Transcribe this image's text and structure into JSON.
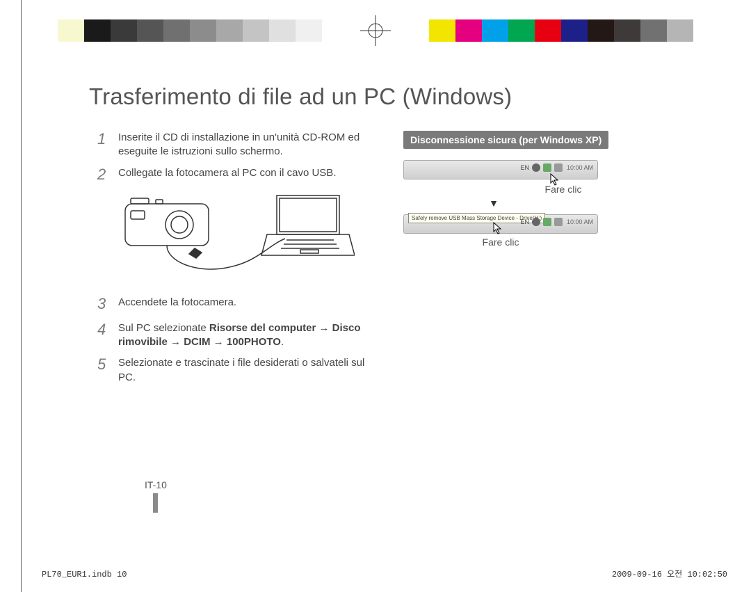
{
  "printer_colors_left": [
    "#ffffff",
    "#f8f8d0",
    "#1a1a1a",
    "#3a3a3a",
    "#555555",
    "#707070",
    "#8c8c8c",
    "#a8a8a8",
    "#c4c4c4",
    "#e0e0e0",
    "#f0f0f0",
    "#ffffff"
  ],
  "printer_colors_right": [
    "#ffffff",
    "#f2e600",
    "#e4007f",
    "#00a1e9",
    "#00a650",
    "#e60012",
    "#1d2088",
    "#231815",
    "#3e3a39",
    "#727171",
    "#b5b5b6",
    "#ffffff"
  ],
  "title": "Trasferimento di file ad un PC (Windows)",
  "steps": [
    {
      "num": "1",
      "text": "Inserite il CD di installazione in un'unità CD-ROM ed eseguite le istruzioni sullo schermo."
    },
    {
      "num": "2",
      "text": "Collegate la fotocamera al PC con il cavo USB."
    },
    {
      "num": "3",
      "text": "Accendete la fotocamera."
    },
    {
      "num": "4",
      "text_prefix": "Sul PC selezionate ",
      "bold1": "Risorse del computer",
      "arrow": " → ",
      "bold2": "Disco rimovibile → DCIM → 100PHOTO",
      "text_suffix": "."
    },
    {
      "num": "5",
      "text": "Selezionate e trascinate i file desiderati o salvateli sul PC."
    }
  ],
  "callout": "Disconnessione sicura (per Windows XP)",
  "taskbar": {
    "lang": "EN",
    "clock": "10:00 AM",
    "tooltip": "Safely remove USB Mass Storage Device - Drive(H:)"
  },
  "captions": {
    "click1": "Fare clic",
    "click2": "Fare clic",
    "arrow_down": "▼"
  },
  "page_number": "IT-10",
  "footer": {
    "left": "PL70_EUR1.indb   10",
    "right": "2009-09-16   오전 10:02:50"
  }
}
